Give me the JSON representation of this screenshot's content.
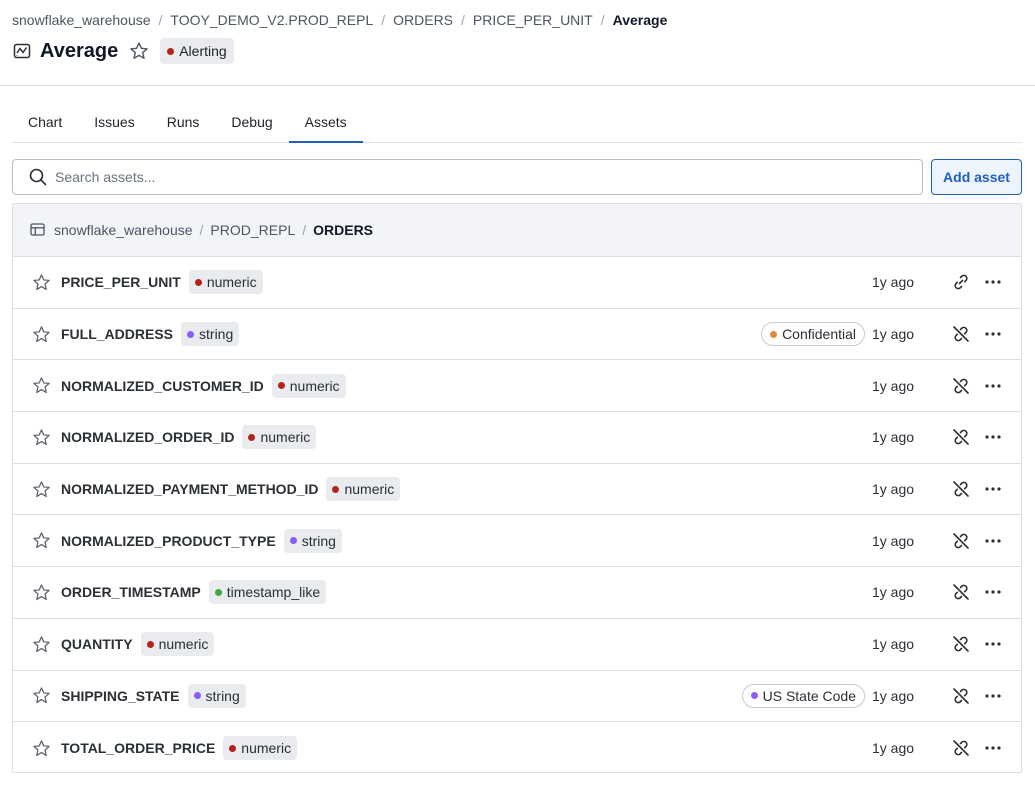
{
  "breadcrumb": [
    {
      "label": "snowflake_warehouse"
    },
    {
      "label": "TOOY_DEMO_V2.PROD_REPL"
    },
    {
      "label": "ORDERS"
    },
    {
      "label": "PRICE_PER_UNIT"
    },
    {
      "label": "Average",
      "current": true
    }
  ],
  "breadcrumb_separator": "/",
  "header": {
    "icon": "monitor-icon",
    "title": "Average",
    "status": {
      "label": "Alerting",
      "color": "#b42318"
    }
  },
  "tabs": [
    {
      "label": "Chart"
    },
    {
      "label": "Issues"
    },
    {
      "label": "Runs"
    },
    {
      "label": "Debug"
    },
    {
      "label": "Assets",
      "active": true
    }
  ],
  "search": {
    "placeholder": "Search assets...",
    "value": ""
  },
  "add_asset_label": "Add asset",
  "table_path": {
    "icon": "table-icon",
    "segments": [
      "snowflake_warehouse",
      "PROD_REPL",
      "ORDERS"
    ]
  },
  "type_colors": {
    "numeric": "#b42318",
    "string": "#8b5cf6",
    "timestamp_like": "#3fa845",
    "Confidential": "#e08a3c",
    "US State Code": "#8b5cf6"
  },
  "assets": [
    {
      "name": "PRICE_PER_UNIT",
      "type": "numeric",
      "updated": "1y ago",
      "linked": true,
      "tag": ""
    },
    {
      "name": "FULL_ADDRESS",
      "type": "string",
      "updated": "1y ago",
      "linked": false,
      "tag": "Confidential"
    },
    {
      "name": "NORMALIZED_CUSTOMER_ID",
      "type": "numeric",
      "updated": "1y ago",
      "linked": false,
      "tag": ""
    },
    {
      "name": "NORMALIZED_ORDER_ID",
      "type": "numeric",
      "updated": "1y ago",
      "linked": false,
      "tag": ""
    },
    {
      "name": "NORMALIZED_PAYMENT_METHOD_ID",
      "type": "numeric",
      "updated": "1y ago",
      "linked": false,
      "tag": ""
    },
    {
      "name": "NORMALIZED_PRODUCT_TYPE",
      "type": "string",
      "updated": "1y ago",
      "linked": false,
      "tag": ""
    },
    {
      "name": "ORDER_TIMESTAMP",
      "type": "timestamp_like",
      "updated": "1y ago",
      "linked": false,
      "tag": ""
    },
    {
      "name": "QUANTITY",
      "type": "numeric",
      "updated": "1y ago",
      "linked": false,
      "tag": ""
    },
    {
      "name": "SHIPPING_STATE",
      "type": "string",
      "updated": "1y ago",
      "linked": false,
      "tag": "US State Code"
    },
    {
      "name": "TOTAL_ORDER_PRICE",
      "type": "numeric",
      "updated": "1y ago",
      "linked": false,
      "tag": ""
    }
  ]
}
